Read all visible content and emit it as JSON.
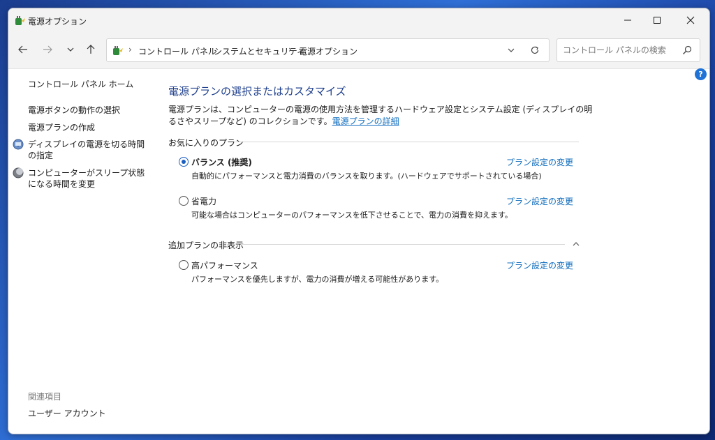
{
  "window": {
    "title": "電源オプション"
  },
  "navbar": {
    "breadcrumb": [
      "コントロール パネル",
      "システムとセキュリティ",
      "電源オプション"
    ],
    "breadcrumb_separator": "›",
    "search_placeholder": "コントロール パネルの検索"
  },
  "help": {
    "label": "?"
  },
  "sidebar": {
    "home": "コントロール パネル ホーム",
    "links": [
      "電源ボタンの動作の選択",
      "電源プランの作成",
      "ディスプレイの電源を切る時間の指定",
      "コンピューターがスリープ状態になる時間を変更"
    ],
    "related_heading": "関連項目",
    "related_links": [
      "ユーザー アカウント"
    ]
  },
  "main": {
    "heading": "電源プランの選択またはカスタマイズ",
    "description": "電源プランは、コンピューターの電源の使用方法を管理するハードウェア設定とシステム設定 (ディスプレイの明るさやスリープなど) のコレクションです。",
    "details_link": "電源プランの詳細",
    "favorites_heading": "お気に入りのプラン",
    "hidden_heading": "追加プランの非表示",
    "change_label": "プラン設定の変更",
    "plans": [
      {
        "name": "バランス (推奨)",
        "description": "自動的にパフォーマンスと電力消費のバランスを取ります。(ハードウェアでサポートされている場合)",
        "selected": true
      },
      {
        "name": "省電力",
        "description": "可能な場合はコンピューターのパフォーマンスを低下させることで、電力の消費を抑えます。",
        "selected": false
      },
      {
        "name": "高パフォーマンス",
        "description": "パフォーマンスを優先しますが、電力の消費が増える可能性があります。",
        "selected": false
      }
    ]
  },
  "colors": {
    "accent": "#1a5fc2",
    "link": "#0f6cbd",
    "heading": "#1e3f8c",
    "help_badge": "#1f73d6"
  }
}
